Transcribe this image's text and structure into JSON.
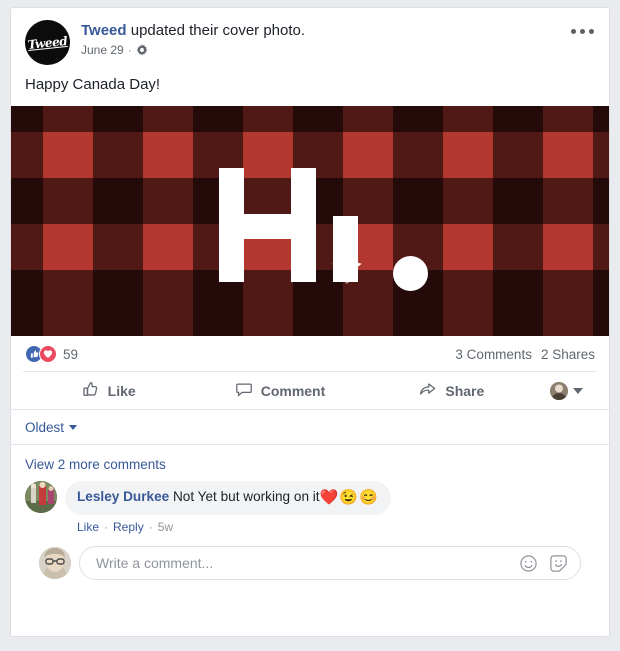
{
  "post": {
    "author": {
      "name": "Tweed",
      "avatar_wordmark": "Tweed",
      "avatar_icon": "tweed-logo-avatar"
    },
    "headline_action": " updated their cover photo.",
    "date": "June 29",
    "meta_separator": "·",
    "privacy_icon": "gear-icon",
    "more_icon": "ellipsis-icon",
    "message": "Happy Canada Day!",
    "cover_photo": {
      "alt": "Buffalo plaid cover photo with Hi. and maple leaf",
      "text": "Hi.",
      "colors": {
        "red": "#b23830",
        "maroon": "#6b201c",
        "dark": "#230d0c",
        "white": "#ffffff"
      }
    }
  },
  "reactions": {
    "like_icon": "thumbs-up-reaction-icon",
    "love_icon": "heart-reaction-icon",
    "count": "59",
    "comments_count": "3 Comments",
    "shares_count": "2 Shares"
  },
  "actions": {
    "like": {
      "label": "Like",
      "icon": "thumbs-up-outline-icon"
    },
    "comment": {
      "label": "Comment",
      "icon": "speech-bubble-icon"
    },
    "share": {
      "label": "Share",
      "icon": "share-arrow-icon"
    },
    "viewer_avatar_icon": "viewer-avatar",
    "viewer_caret_icon": "chevron-down-icon"
  },
  "comments_section": {
    "sort_label": "Oldest",
    "sort_caret_icon": "chevron-down-icon",
    "view_more": "View 2 more comments",
    "comments": [
      {
        "author": "Lesley Durkee",
        "text": " Not Yet but working on it",
        "emoji": "❤️😉😊",
        "like_label": "Like",
        "reply_label": "Reply",
        "separator": "·",
        "age": "5w",
        "avatar_icon": "commenter-avatar"
      }
    ]
  },
  "composer": {
    "avatar_icon": "current-user-avatar",
    "placeholder": "Write a comment...",
    "value": "",
    "emoji_icon": "emoji-smiley-icon",
    "sticker_icon": "sticker-icon"
  },
  "colors": {
    "link_blue": "#385898",
    "text_dark": "#1d2129",
    "text_muted": "#616770",
    "page_bg": "#e9ebee",
    "card_bg": "#ffffff",
    "bubble_bg": "#f2f3f5"
  }
}
